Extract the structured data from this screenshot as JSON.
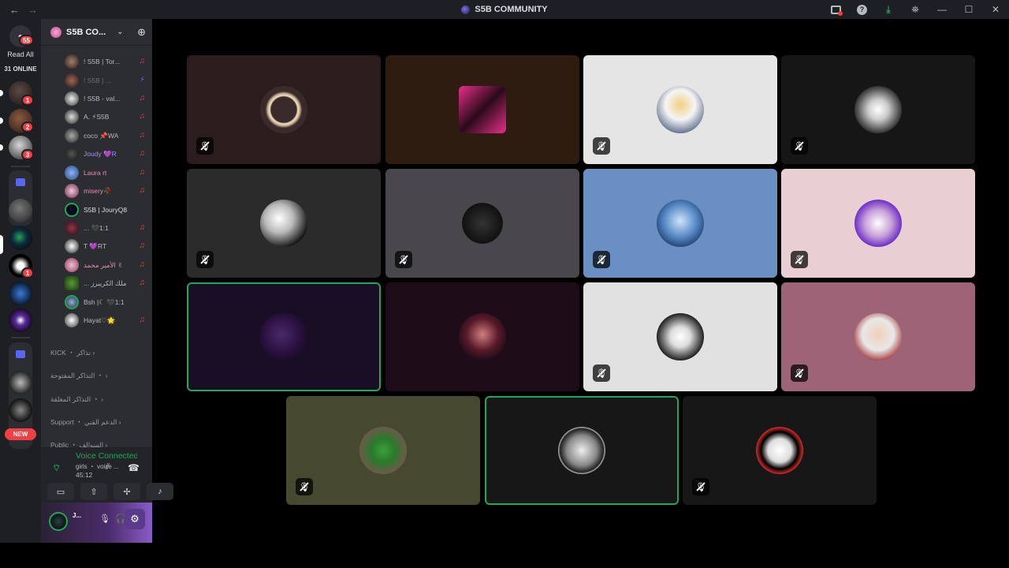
{
  "window": {
    "title": "S5B COMMUNITY"
  },
  "rail": {
    "home_badge": "55",
    "read_all": "Read All",
    "online": "31 ONLINE",
    "dm_badges": [
      "1",
      "2",
      "3"
    ],
    "server_badge": "1",
    "new_label": "NEW"
  },
  "server": {
    "name": "S5B CO..."
  },
  "voice_users": [
    {
      "name": "! S5B | Tor..."
    },
    {
      "name": "! S5B | ..."
    },
    {
      "name": "! S5B - val..."
    },
    {
      "name": "A. ⚡S5B"
    },
    {
      "name": "coco 📌WA"
    },
    {
      "name": "Joudy 💜R"
    },
    {
      "name": "Laura rt"
    },
    {
      "name": "misery🥀"
    },
    {
      "name": "S5B | JouryQ8"
    },
    {
      "name": "... 🖤1:1"
    },
    {
      "name": "T 💜RT"
    },
    {
      "name": "الأمير محمد ✌"
    },
    {
      "name": "... ملك الكريبرز"
    },
    {
      "name": "Bsh |☾ 🖤1:1"
    },
    {
      "name": "Hayat♡🌟"
    }
  ],
  "categories": [
    {
      "label": "KICK ・ تذاكر ›"
    },
    {
      "label": "التذاكر المفتوحة ・ ›"
    },
    {
      "label": "التذاكر المغلقة ・ ›"
    },
    {
      "label": "Support ・ الدعم الفني ›"
    },
    {
      "label": "Public ・ السوالف ›"
    }
  ],
  "voice_panel": {
    "status": "Voice Connected",
    "channel": "girls ・ voice ...",
    "elapsed": "45:12"
  },
  "user_panel": {
    "name": "J...",
    "status": ""
  },
  "colors": {
    "speaking": "#23a55a",
    "rail_bg": "#1e1f22",
    "sidebar_bg": "#2b2d31",
    "danger": "#f23f43"
  },
  "stage_tiles": [
    {
      "bg": "#2b1d1d",
      "avatar": "user-1",
      "muted": true,
      "speaking": false
    },
    {
      "bg": "#2e1c10",
      "avatar": "user-2",
      "muted": false,
      "speaking": false
    },
    {
      "bg": "#e6e5e5",
      "avatar": "user-3",
      "muted": true,
      "speaking": false
    },
    {
      "bg": "#161616",
      "avatar": "user-4",
      "muted": true,
      "speaking": false
    },
    {
      "bg": "#2b2b2b",
      "avatar": "user-5",
      "muted": true,
      "speaking": false
    },
    {
      "bg": "#4a474c",
      "avatar": "user-6",
      "muted": true,
      "speaking": false
    },
    {
      "bg": "#6a8fc2",
      "avatar": "user-7",
      "muted": true,
      "speaking": false
    },
    {
      "bg": "#e9cfd2",
      "avatar": "user-8",
      "muted": true,
      "speaking": false
    },
    {
      "bg": "#1a0d26",
      "avatar": "user-9",
      "muted": false,
      "speaking": true
    },
    {
      "bg": "#1e0d18",
      "avatar": "user-10",
      "muted": false,
      "speaking": false
    },
    {
      "bg": "#e1e1e1",
      "avatar": "user-11",
      "muted": true,
      "speaking": false
    },
    {
      "bg": "#9c6476",
      "avatar": "user-12",
      "muted": true,
      "speaking": false
    },
    {
      "bg": "#46492e",
      "avatar": "user-13",
      "muted": true,
      "speaking": false
    },
    {
      "bg": "#171717",
      "avatar": "user-14",
      "muted": false,
      "speaking": true
    },
    {
      "bg": "#171717",
      "avatar": "user-15",
      "muted": true,
      "speaking": false
    }
  ]
}
